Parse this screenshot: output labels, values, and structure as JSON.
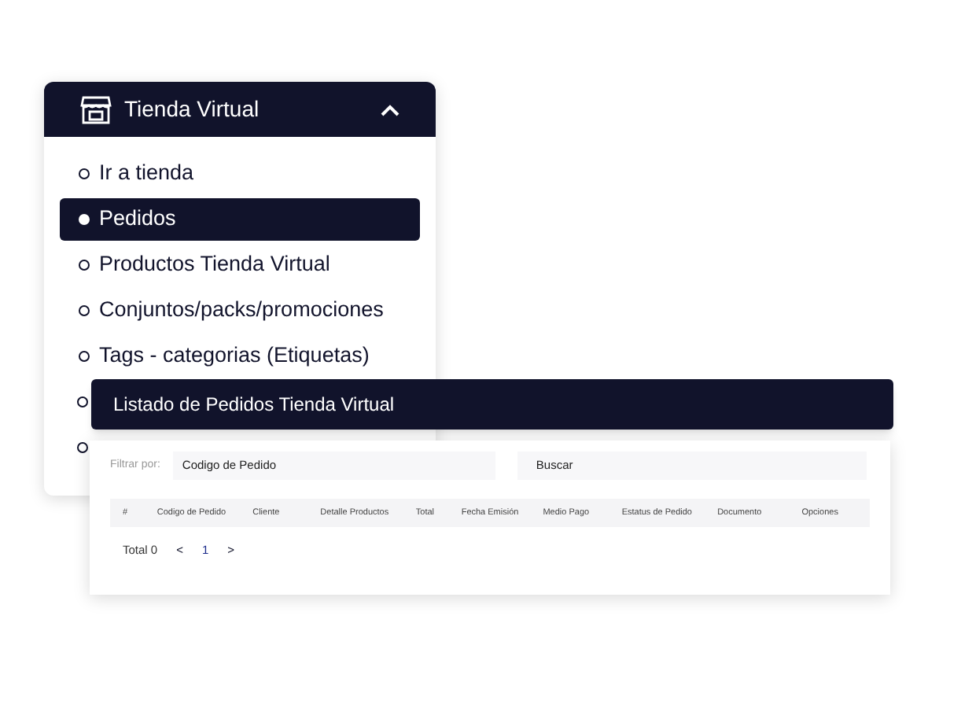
{
  "menu": {
    "title": "Tienda Virtual",
    "expanded": true,
    "items": [
      {
        "label": "Ir a tienda",
        "selected": false
      },
      {
        "label": "Pedidos",
        "selected": true
      },
      {
        "label": "Productos Tienda Virtual",
        "selected": false
      },
      {
        "label": "Conjuntos/packs/promociones",
        "selected": false
      },
      {
        "label": "Tags - categorias (Etiquetas)",
        "selected": false
      },
      {
        "selected": false
      },
      {
        "selected": false
      }
    ]
  },
  "panel": {
    "title": "Listado de Pedidos Tienda Virtual",
    "filter": {
      "label": "Filtrar por:",
      "value": "Codigo de Pedido",
      "button": "Buscar"
    },
    "table": {
      "columns": [
        "#",
        "Codigo de Pedido",
        "Cliente",
        "Detalle Productos",
        "Total",
        "Fecha Emisión",
        "Medio Pago",
        "Estatus de Pedido",
        "Documento",
        "Opciones"
      ]
    },
    "pagination": {
      "total": "Total 0",
      "prev": "<",
      "page": "1",
      "next": ">"
    }
  }
}
